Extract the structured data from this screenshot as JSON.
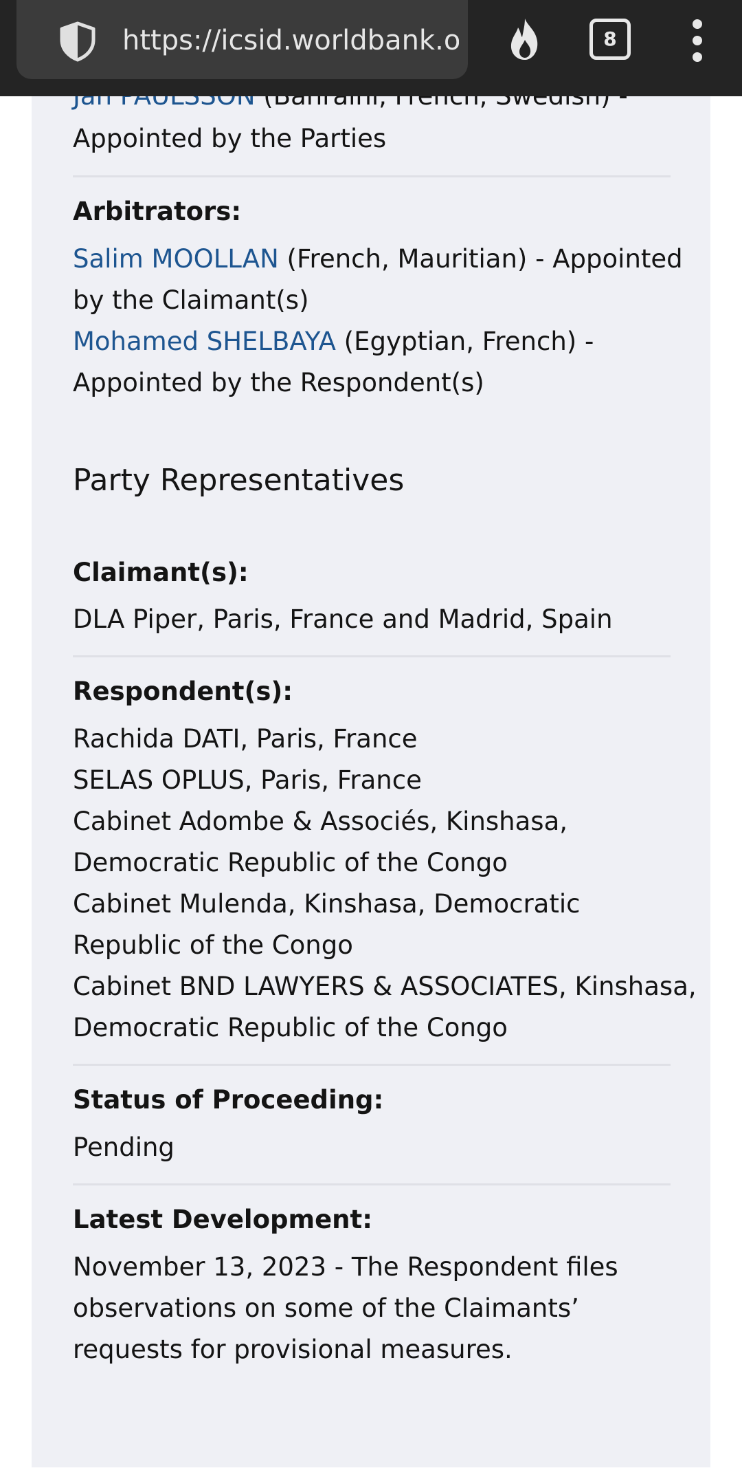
{
  "browser": {
    "url": "https://icsid.worldbank.org",
    "tab_count": "8",
    "icons": [
      "shield-icon",
      "fire-icon",
      "tabs-icon",
      "overflow-menu-icon"
    ]
  },
  "tribunal": {
    "president_name": "Jan PAULSSON",
    "president_detail": " (Bahraini, French, Swedish) -",
    "president_appointed": "Appointed by the Parties",
    "arbitrators_label": "Arbitrators:",
    "arbitrators": [
      {
        "name": "Salim MOOLLAN",
        "detail": " (French, Mauritian) - Appointed",
        "detail2": "by the Claimant(s)"
      },
      {
        "name": "Mohamed SHELBAYA",
        "detail": " (Egyptian, French) -",
        "detail2": "Appointed by the Respondent(s)"
      }
    ]
  },
  "representatives": {
    "heading": "Party Representatives",
    "claimant_label": "Claimant(s):",
    "claimant_lines": [
      "DLA Piper, Paris, France and Madrid, Spain"
    ],
    "respondent_label": "Respondent(s):",
    "respondent_lines": [
      "Rachida DATI, Paris, France",
      "SELAS OPLUS, Paris, France",
      "Cabinet Adombe & Associés, Kinshasa,",
      "Democratic Republic of the Congo",
      "Cabinet Mulenda, Kinshasa, Democratic",
      "Republic of the Congo",
      "Cabinet BND LAWYERS & ASSOCIATES, Kinshasa,",
      "Democratic Republic of the Congo"
    ]
  },
  "status": {
    "label": "Status of Proceeding:",
    "value": "Pending"
  },
  "latest": {
    "label": "Latest Development:",
    "lines": [
      "November 13, 2023 - The Respondent files",
      "observations on some of the Claimants’",
      "requests for provisional measures."
    ]
  },
  "colors": {
    "link": "#1d5590",
    "card": "#eff0f5",
    "toolbar": "#242424"
  }
}
